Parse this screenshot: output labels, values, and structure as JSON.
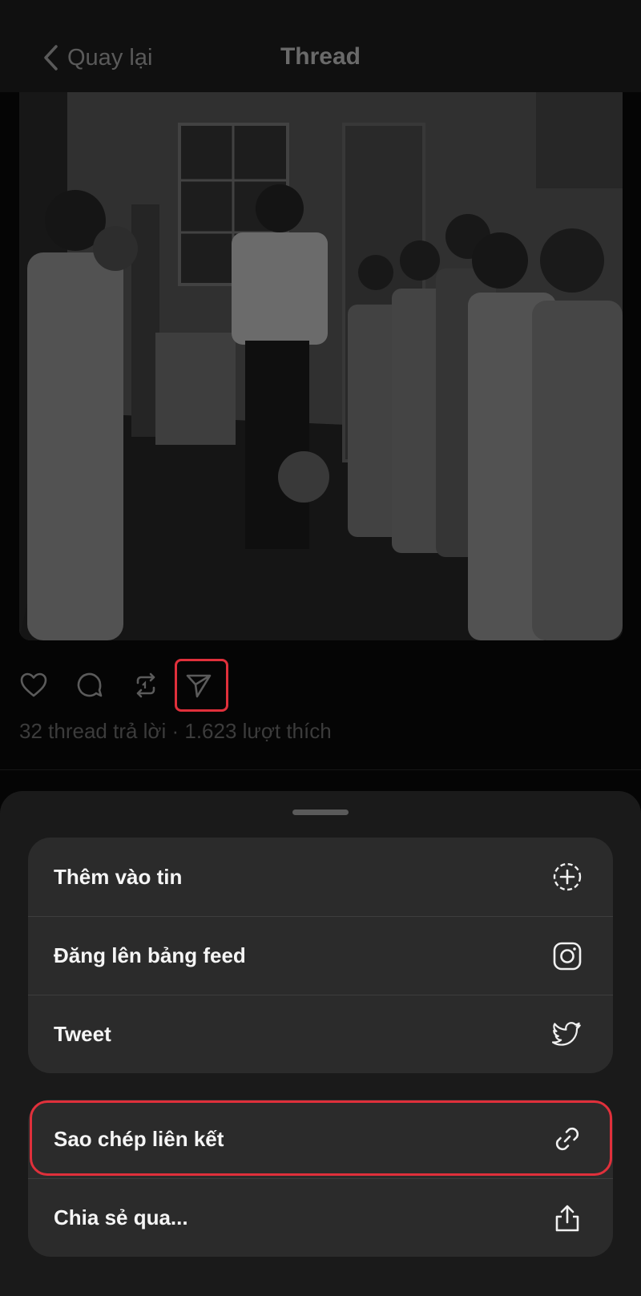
{
  "header": {
    "back_label": "Quay lại",
    "title": "Thread"
  },
  "post": {
    "stats": "32 thread trả lời · 1.623 lượt thích"
  },
  "share_sheet": {
    "group1": [
      {
        "label": "Thêm vào tin",
        "icon": "add-circle-icon"
      },
      {
        "label": "Đăng lên bảng feed",
        "icon": "instagram-icon"
      },
      {
        "label": "Tweet",
        "icon": "twitter-icon"
      }
    ],
    "group2": [
      {
        "label": "Sao chép liên kết",
        "icon": "link-icon"
      },
      {
        "label": "Chia sẻ qua...",
        "icon": "share-out-icon"
      }
    ]
  },
  "colors": {
    "highlight": "#e0303b",
    "sheet_bg": "#1a1a1a",
    "row_bg": "#2b2b2b"
  }
}
